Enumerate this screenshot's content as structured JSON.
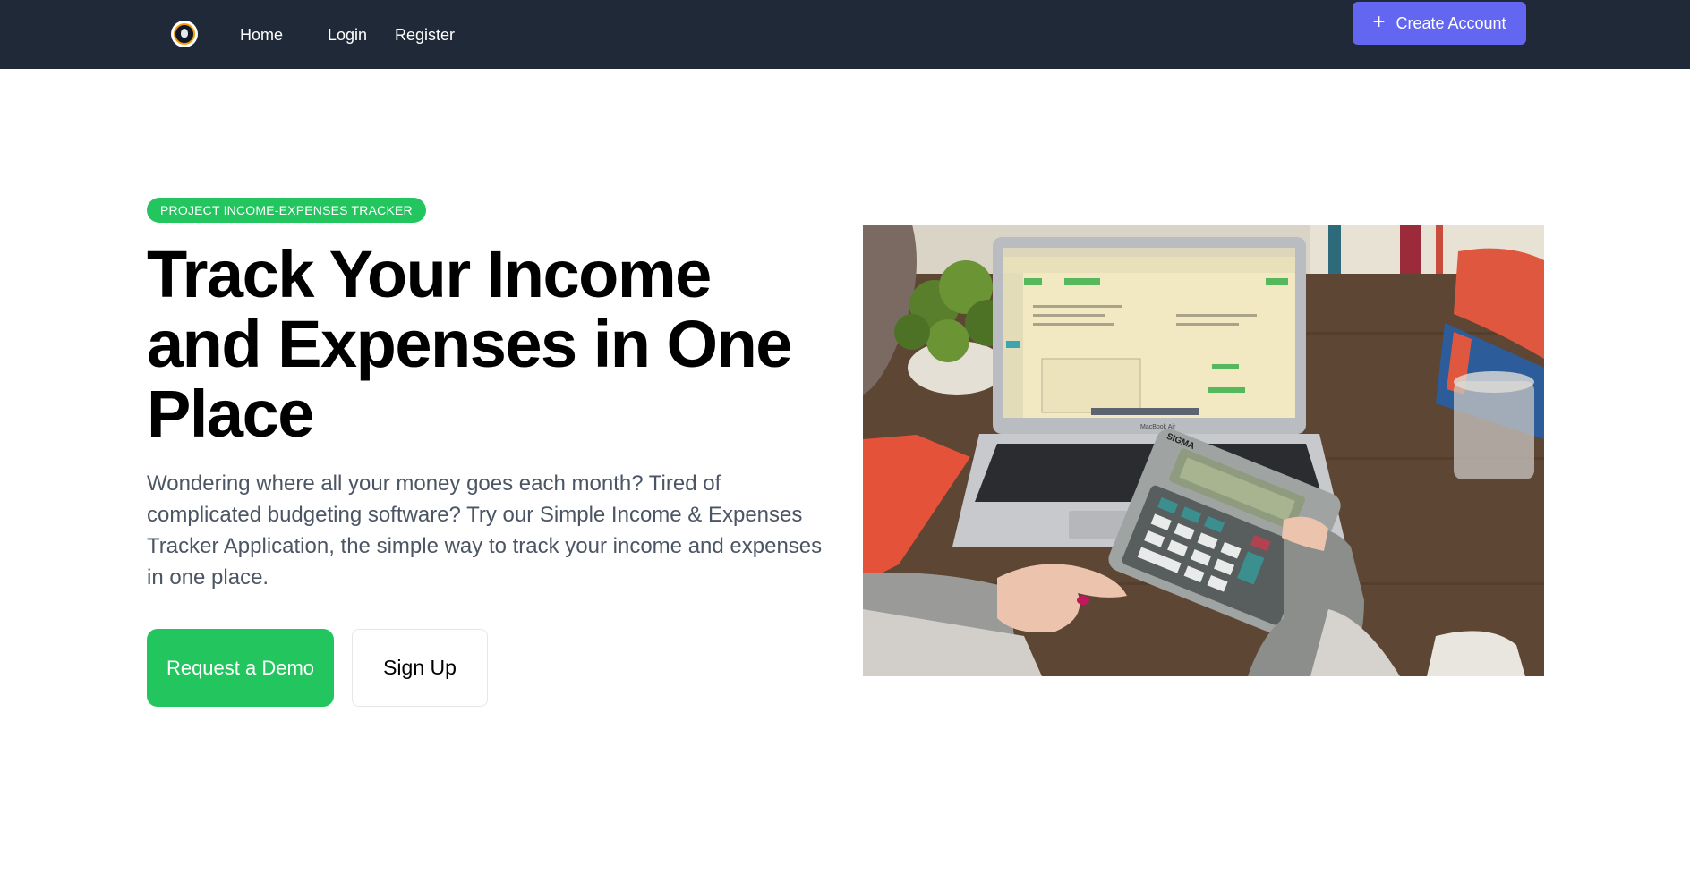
{
  "nav": {
    "logo_icon": "logo-icon",
    "links": [
      "Home",
      "Login",
      "Register"
    ],
    "create_account_label": "Create Account",
    "create_account_icon": "plus-icon",
    "background_color": "#1f2937",
    "accent_color": "#6366f1"
  },
  "hero": {
    "badge": "PROJECT INCOME-EXPENSES TRACKER",
    "title": "Track Your Income and Expenses in One Place",
    "description": "Wondering where all your money goes each month? Tired of complicated budgeting software? Try our Simple Income & Expenses Tracker Application, the simple way to track your income and expenses in one place.",
    "demo_button": "Request a Demo",
    "signup_button": "Sign Up",
    "primary_color": "#22c55e"
  },
  "image": {
    "calculator_brand": "SIGMA",
    "laptop_brand": "MacBook Air"
  }
}
